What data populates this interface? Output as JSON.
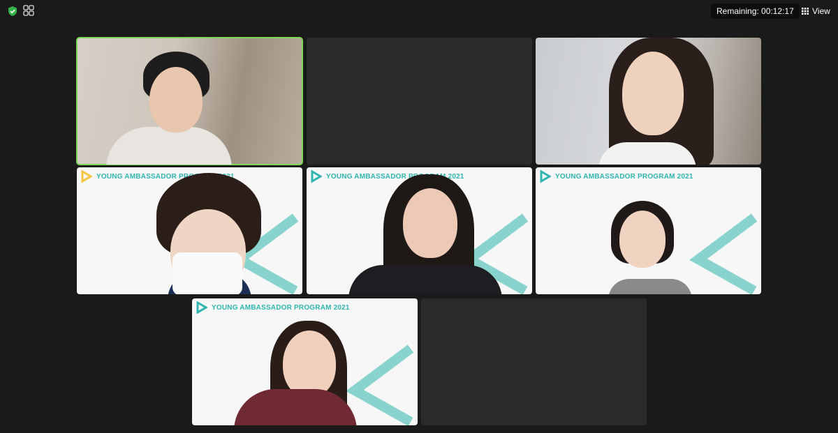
{
  "topbar": {
    "security_icon": "shield-check-icon",
    "gallery_icon": "gallery-grid-icon",
    "remaining_label": "Remaining: 00:12:17",
    "view_label": "View",
    "view_icon": "grid-icon"
  },
  "tiles": [
    {
      "id": "tile-1",
      "background": "room",
      "active": true
    },
    {
      "id": "tile-2",
      "background": "empty"
    },
    {
      "id": "tile-3",
      "background": "room"
    },
    {
      "id": "tile-4",
      "background": "banner",
      "banner_text": "YOUNG AMBASSADOR PROGRAM 2021"
    },
    {
      "id": "tile-5",
      "background": "banner",
      "banner_text": "YOUNG AMBASSADOR PROGRAM 2021"
    },
    {
      "id": "tile-6",
      "background": "banner",
      "banner_text": "YOUNG AMBASSADOR PROGRAM 2021"
    },
    {
      "id": "tile-7",
      "background": "banner",
      "banner_text": "YOUNG AMBASSADOR PROGRAM 2021"
    },
    {
      "id": "tile-8",
      "background": "empty"
    }
  ],
  "colors": {
    "background": "#1a1a1a",
    "active_speaker": "#7ed957",
    "banner_text": "#2fb6b0"
  }
}
